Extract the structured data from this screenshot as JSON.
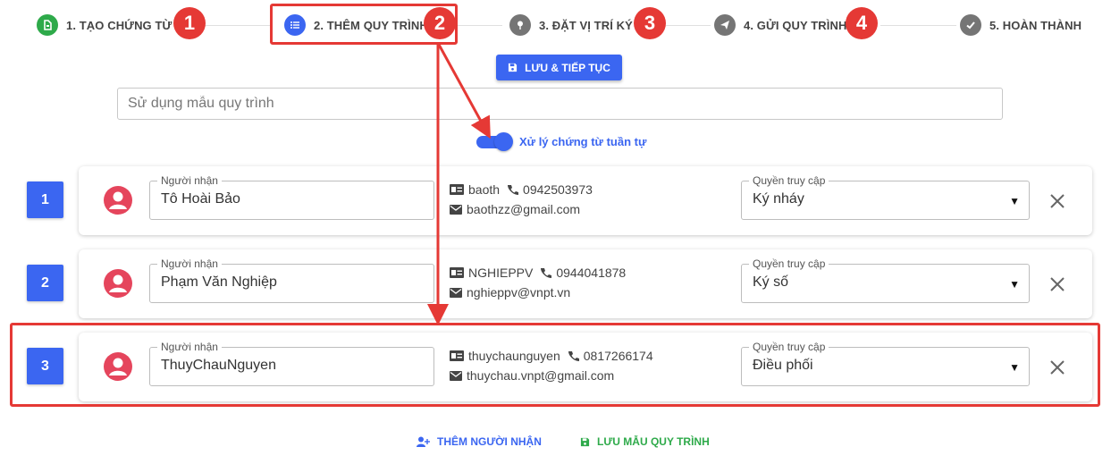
{
  "stepper": {
    "steps": [
      {
        "label": "1. TẠO CHỨNG TỪ",
        "icon": "document-icon",
        "color": "#2eaa4a"
      },
      {
        "label": "2. THÊM QUY TRÌNH",
        "icon": "list-icon",
        "color": "#3b66f1"
      },
      {
        "label": "3. ĐẶT VỊ TRÍ KÝ",
        "icon": "pin-icon",
        "color": "#757575"
      },
      {
        "label": "4. GỬI QUY TRÌNH",
        "icon": "send-icon",
        "color": "#757575"
      },
      {
        "label": "5. HOÀN THÀNH",
        "icon": "check-icon",
        "color": "#757575"
      }
    ],
    "badges": [
      "1",
      "2",
      "3",
      "4"
    ]
  },
  "toolbar": {
    "save_label": "LƯU & TIẾP TỤC"
  },
  "template": {
    "placeholder": "Sử dụng mẫu quy trình"
  },
  "toggle": {
    "label": "Xử lý chứng từ tuần tự",
    "on": true
  },
  "field_labels": {
    "recipient": "Người nhận",
    "access": "Quyền truy cập"
  },
  "recipients": [
    {
      "index": "1",
      "name": "Tô Hoài Bảo",
      "username": "baoth",
      "phone": "0942503973",
      "email": "baothzz@gmail.com",
      "access": "Ký nháy"
    },
    {
      "index": "2",
      "name": "Phạm Văn Nghiệp",
      "username": "NGHIEPPV",
      "phone": "0944041878",
      "email": "nghieppv@vnpt.vn",
      "access": "Ký số"
    },
    {
      "index": "3",
      "name": "ThuyChauNguyen",
      "username": "thuychaunguyen",
      "phone": "0817266174",
      "email": "thuychau.vnpt@gmail.com",
      "access": "Điều phối"
    }
  ],
  "footer": {
    "add_recipient": "THÊM NGƯỜI NHẬN",
    "save_template": "LƯU MẪU QUY TRÌNH"
  },
  "colors": {
    "primary": "#3b66f1",
    "success": "#2eaa4a",
    "highlight": "#e53935",
    "avatar": "#e5455c"
  }
}
